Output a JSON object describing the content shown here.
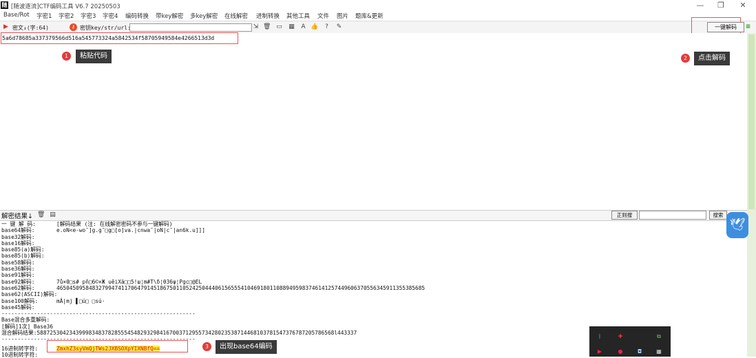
{
  "window": {
    "title": "[随波逐流]CTF编码工具 V6.7  20250503",
    "logo": "随",
    "controls": [
      "—",
      "❐",
      "✕"
    ]
  },
  "menu": [
    "Base/Rot",
    "字密1",
    "字密2",
    "字密3",
    "字密4",
    "编码转换",
    "带key解密",
    "多key解密",
    "在线解密",
    "进制转换",
    "其他工具",
    "文件",
    "图片",
    "题库&更新"
  ],
  "toolbar": {
    "cipher_label": "密文↓(字:64)",
    "key_label": "密钥key/str/url:",
    "key_value": "",
    "decode_button": "一键解码"
  },
  "cipher_text": "5a6d78685a337379566d516a545773324a5842534f58705949584e4266513d3d",
  "annotations": {
    "a1": {
      "num": "1",
      "text": "粘贴代码"
    },
    "a2": {
      "num": "2",
      "text": "点击解码"
    },
    "a3": {
      "num": "3",
      "text": "出现base64编码"
    }
  },
  "result_bar": {
    "label": "解密结果↓",
    "regex_button": "正则搜",
    "search_value": "",
    "search_button": "搜索"
  },
  "output": [
    {
      "label": "一 键 解 码:",
      "value": "[解码结果 (注: 在线解密密码不参与一键解码)"
    },
    {
      "label": "base64解码:",
      "value": "e.oN<e-wo˜]g.g˜□g□[o]va.|cnwa˜|oN|c˜|an6k.u]]]"
    },
    {
      "label": "base32解码:",
      "value": ""
    },
    {
      "label": "base16解码:",
      "value": ""
    },
    {
      "label": "base85(a)解码:",
      "value": ""
    },
    {
      "label": "base85(b)解码:",
      "value": ""
    },
    {
      "label": "base58解码:",
      "value": ""
    },
    {
      "label": "base36解码:",
      "value": ""
    },
    {
      "label": "base91解码:",
      "value": ""
    },
    {
      "label": "base92解码:",
      "value": "7ů×0□s# pň□6©×Ж  uěiXă□□5!ш¦m#T\\δ¦θ36ψ¦Pgc□@EL"
    },
    {
      "label": "base62解码:",
      "value": "465045095848327994741170647914518675011052425044406156555410469180110889495983746141257449606370556345911355385685"
    },
    {
      "label": "base62(ASCII)解码:",
      "value": ""
    },
    {
      "label": "base100解码:",
      "value": "mÂ|mj ▌□ú□ □sú·"
    },
    {
      "label": "base45解码:",
      "value": ""
    },
    {
      "label": "",
      "value": "------------------------------------------------------------"
    },
    {
      "label": "",
      "value": "Base混合多重解码:"
    },
    {
      "label": "",
      "value": "[解码]1次] Base36"
    },
    {
      "label": "",
      "value": "混合解码结果:58872530423439998348378285554548293298416700371295573428023538714468103781547376787205786568l443337"
    },
    {
      "label": "",
      "value": "------------------------------------------------------------"
    },
    {
      "label": "16进制转字符:",
      "value": "ZmxhZ3syVmQjTWs2JXBSOXpYIXNBfQ==",
      "highlight": true
    },
    {
      "label": "10进制转字符:",
      "value": ""
    }
  ],
  "avatar_icon": "bird-icon"
}
